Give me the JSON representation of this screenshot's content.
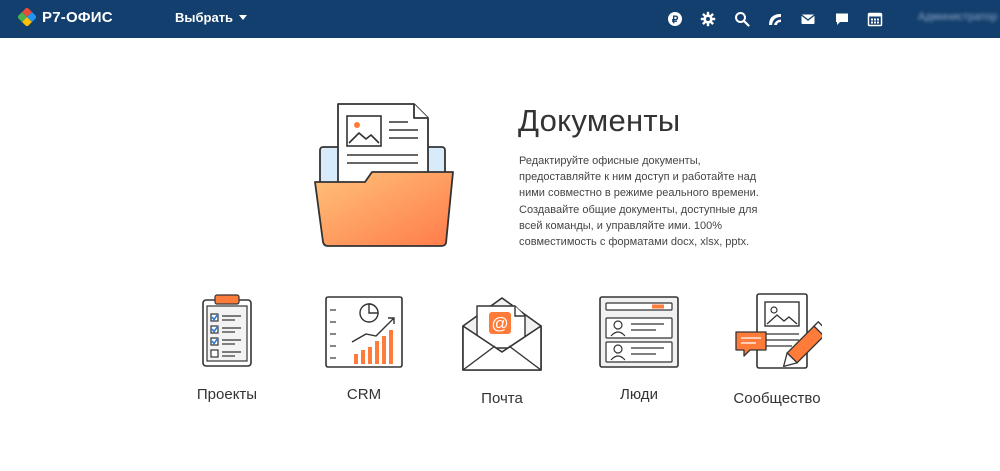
{
  "header": {
    "logo_text": "Р7-ОФИС",
    "module_select_label": "Выбрать",
    "user_name": "Администратор"
  },
  "hero": {
    "title": "Документы",
    "description": "Редактируйте офисные документы, предоставляйте к ним доступ и работайте над ними совместно в режиме реального времени. Создавайте общие документы, доступные для всей команды, и управляйте ими. 100% совместимость с форматами docx, xlsx, pptx."
  },
  "modules": [
    {
      "label": "Проекты",
      "icon": "clipboard-checklist-icon"
    },
    {
      "label": "CRM",
      "icon": "crm-chart-icon"
    },
    {
      "label": "Почта",
      "icon": "mail-envelope-icon"
    },
    {
      "label": "Люди",
      "icon": "people-cards-icon"
    },
    {
      "label": "Сообщество",
      "icon": "community-pencil-icon"
    }
  ],
  "colors": {
    "header_bg": "#133f6e",
    "accent_orange": "#ff7b3a",
    "folder_orange": "#ffb066",
    "outline": "#333333"
  }
}
